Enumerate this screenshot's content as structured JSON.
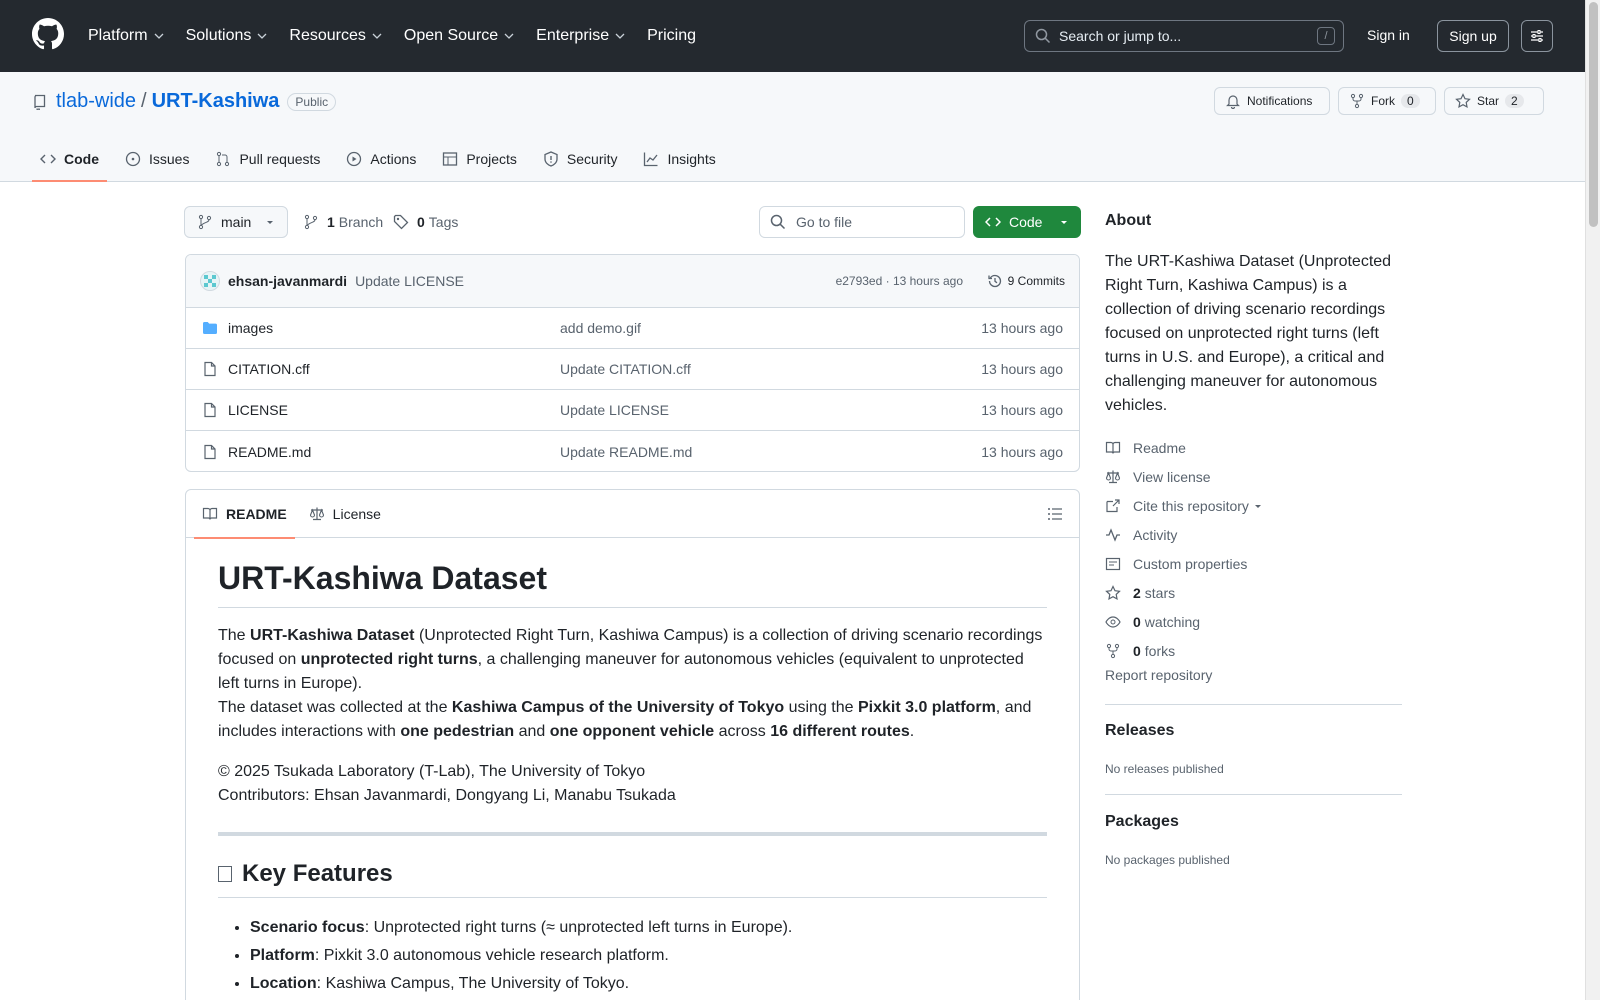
{
  "header": {
    "nav": [
      "Platform",
      "Solutions",
      "Resources",
      "Open Source",
      "Enterprise",
      "Pricing"
    ],
    "search_placeholder": "Search or jump to...",
    "search_shortcut": "/",
    "signin": "Sign in",
    "signup": "Sign up"
  },
  "repo": {
    "owner": "tlab-wide",
    "separator": "/",
    "name": "URT-Kashiwa",
    "visibility": "Public",
    "notifications": "Notifications",
    "fork_label": "Fork",
    "fork_count": "0",
    "star_label": "Star",
    "star_count": "2"
  },
  "tabs": [
    "Code",
    "Issues",
    "Pull requests",
    "Actions",
    "Projects",
    "Security",
    "Insights"
  ],
  "branch_bar": {
    "branch": "main",
    "branch_count": "1",
    "branch_label": "Branch",
    "tag_count": "0",
    "tag_label": "Tags",
    "goto_placeholder": "Go to file",
    "code_button": "Code"
  },
  "latest_commit": {
    "author": "ehsan-javanmardi",
    "message": "Update LICENSE",
    "meta": "e2793ed · 13 hours ago",
    "commits": "9 Commits"
  },
  "files": [
    {
      "name": "images",
      "type": "folder",
      "commit": "add demo.gif",
      "time": "13 hours ago"
    },
    {
      "name": "CITATION.cff",
      "type": "file",
      "commit": "Update CITATION.cff",
      "time": "13 hours ago"
    },
    {
      "name": "LICENSE",
      "type": "file",
      "commit": "Update LICENSE",
      "time": "13 hours ago"
    },
    {
      "name": "README.md",
      "type": "file",
      "commit": "Update README.md",
      "time": "13 hours ago"
    }
  ],
  "readme": {
    "tab_readme": "README",
    "tab_license": "License",
    "title": "URT-Kashiwa Dataset",
    "p1": {
      "t1": "The ",
      "b1": "URT-Kashiwa Dataset",
      "t2": " (Unprotected Right Turn, Kashiwa Campus) is a collection of driving scenario recordings focused on ",
      "b2": "unprotected right turns",
      "t3": ", a challenging maneuver for autonomous vehicles (equivalent to unprotected left turns in Europe).",
      "t4": "The dataset was collected at the ",
      "b3": "Kashiwa Campus of the University of Tokyo",
      "t5": " using the ",
      "b4": "Pixkit 3.0 platform",
      "t6": ", and includes interactions with ",
      "b5": "one pedestrian",
      "t7": " and ",
      "b6": "one opponent vehicle",
      "t8": " across ",
      "b7": "16 different routes",
      "t9": "."
    },
    "copyright": "© 2025 Tsukada Laboratory (T-Lab), The University of Tokyo",
    "contributors": "Contributors: Ehsan Javanmardi, Dongyang Li, Manabu Tsukada",
    "h2": "Key Features",
    "features": [
      {
        "label": "Scenario focus",
        "text": ": Unprotected right turns (≈ unprotected left turns in Europe)."
      },
      {
        "label": "Platform",
        "text": ": Pixkit 3.0 autonomous vehicle research platform."
      },
      {
        "label": "Location",
        "text": ": Kashiwa Campus, The University of Tokyo."
      }
    ]
  },
  "sidebar": {
    "about_title": "About",
    "description": "The URT-Kashiwa Dataset (Unprotected Right Turn, Kashiwa Campus) is a collection of driving scenario recordings focused on unprotected right turns (left turns in U.S. and Europe), a critical and challenging maneuver for autonomous vehicles.",
    "readme": "Readme",
    "license": "View license",
    "cite": "Cite this repository",
    "activity": "Activity",
    "custom": "Custom properties",
    "stars_count": "2",
    "stars_label": "stars",
    "watching_count": "0",
    "watching_label": "watching",
    "forks_count": "0",
    "forks_label": "forks",
    "report": "Report repository",
    "releases_title": "Releases",
    "releases_text": "No releases published",
    "packages_title": "Packages",
    "packages_text": "No packages published"
  },
  "colors": {
    "header_bg": "#24292f",
    "link": "#0969da",
    "code_button": "#1f883d",
    "active_tab": "#fd8c73"
  }
}
